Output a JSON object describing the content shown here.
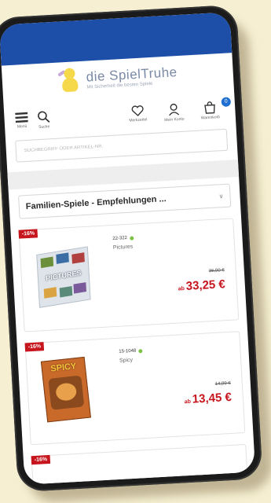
{
  "brand": {
    "name": "die SpielTruhe",
    "tagline": "Mit Sicherheit die besten Spiele"
  },
  "header": {
    "menu_label": "Menü",
    "search_label": "Suche",
    "wishlist_label": "Merkzettel",
    "account_label": "Mein Konto",
    "cart_label": "Warenkorb",
    "cart_count": "0"
  },
  "search": {
    "placeholder": "SUCHBEGRIFF ODER ARTIKEL-NR."
  },
  "category": {
    "selected": "Familien-Spiele - Empfehlungen ..."
  },
  "products": [
    {
      "discount": "-16%",
      "sku": "22-322",
      "name": "Pictures",
      "box_title": "PICTURES",
      "price_old": "36,90 €",
      "price_prefix": "ab",
      "price_new": "33,25 €"
    },
    {
      "discount": "-16%",
      "sku": "15-1048",
      "name": "Spicy",
      "box_title": "SPICY",
      "price_old": "14,99 €",
      "price_prefix": "ab",
      "price_new": "13,45 €"
    },
    {
      "discount": "-16%"
    }
  ],
  "colors": {
    "header_blue": "#1e4fa8",
    "discount_red": "#c7151e",
    "stock_green": "#7cc243",
    "background": "#f6efd2"
  }
}
